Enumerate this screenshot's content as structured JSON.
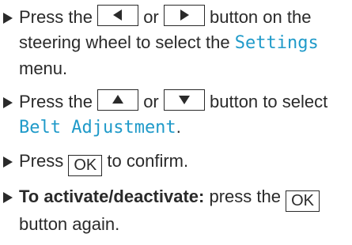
{
  "steps": [
    {
      "line1_a": "Press the",
      "line1_b": "or",
      "line1_c": "button on the",
      "line2_a": "steering wheel to select the",
      "line2_display": "Settings",
      "line3": "menu."
    },
    {
      "line1_a": "Press the",
      "line1_b": "or",
      "line1_c": "button to select",
      "line2_display": "Belt Adjustment",
      "line2_tail": "."
    },
    {
      "a": "Press",
      "key": "OK",
      "b": "to confirm."
    },
    {
      "bold": "To activate/deactivate:",
      "a": "press the",
      "key": "OK",
      "line2": "button again."
    }
  ],
  "icons": {
    "left": "left-arrow-key-icon",
    "right": "right-arrow-key-icon",
    "up": "up-arrow-key-icon",
    "down": "down-arrow-key-icon",
    "bullet": "triangle-bullet-icon"
  },
  "colors": {
    "text": "#2a2a2a",
    "display_text": "#1f9ac9"
  }
}
